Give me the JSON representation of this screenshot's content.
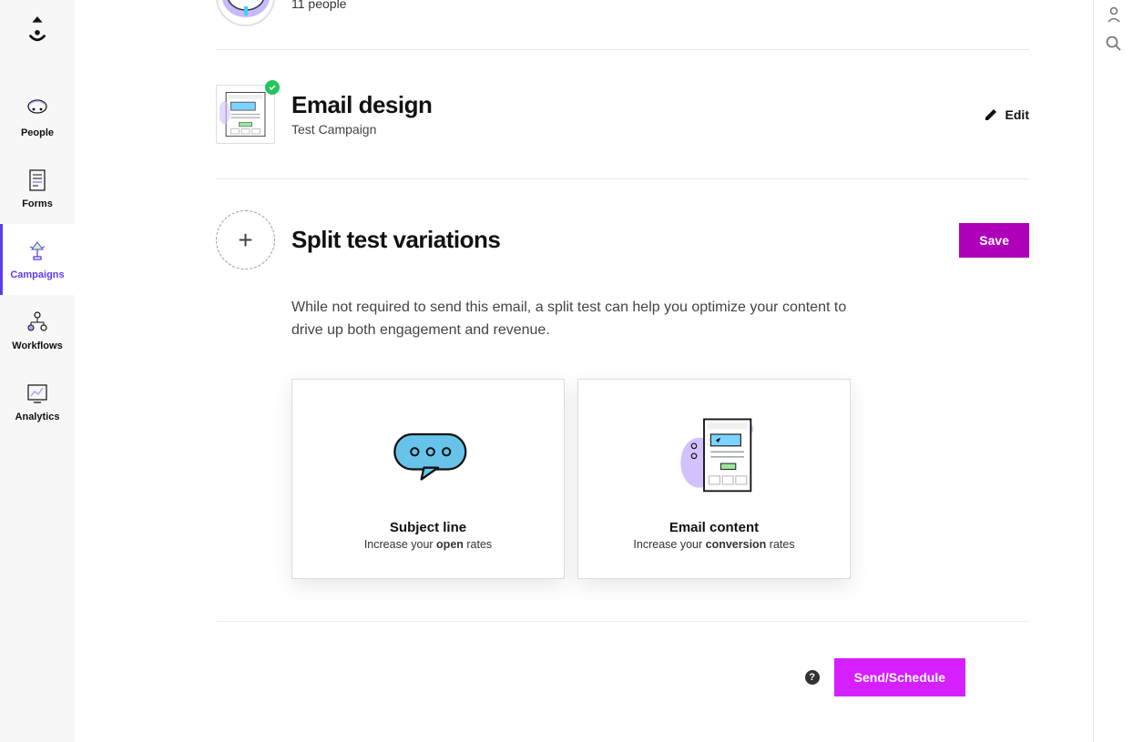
{
  "sidebar": {
    "items": [
      {
        "id": "people",
        "label": "People"
      },
      {
        "id": "forms",
        "label": "Forms"
      },
      {
        "id": "campaigns",
        "label": "Campaigns"
      },
      {
        "id": "workflows",
        "label": "Workflows"
      },
      {
        "id": "analytics",
        "label": "Analytics"
      }
    ]
  },
  "sections": {
    "audience": {
      "people_count": "11 people"
    },
    "email_design": {
      "title": "Email design",
      "sub": "Test Campaign",
      "edit": "Edit"
    },
    "split_test": {
      "title": "Split test variations",
      "save": "Save",
      "desc": "While not required to send this email, a split test can help you optimize your content to drive up both engagement and revenue.",
      "cards": [
        {
          "title": "Subject line",
          "sub_prefix": "Increase your ",
          "sub_bold": "open",
          "sub_suffix": " rates"
        },
        {
          "title": "Email content",
          "sub_prefix": "Increase your ",
          "sub_bold": "conversion",
          "sub_suffix": " rates"
        }
      ]
    }
  },
  "footer": {
    "help": "?",
    "send": "Send/Schedule"
  },
  "colors": {
    "accent": "#5e3bee",
    "save": "#ae00b9",
    "primary_btn": "#d61fff",
    "success": "#22c55e"
  }
}
